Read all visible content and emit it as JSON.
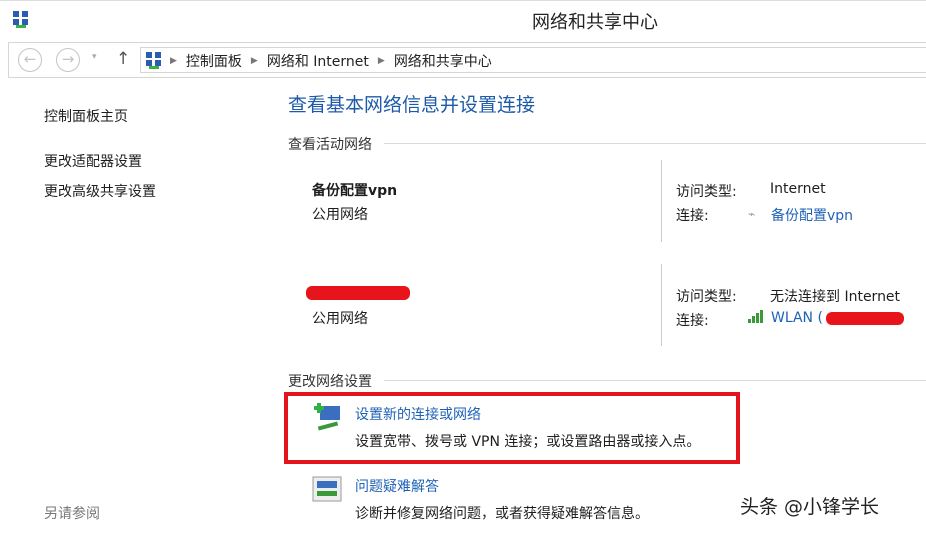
{
  "window": {
    "title": "网络和共享中心"
  },
  "breadcrumb": [
    "控制面板",
    "网络和 Internet",
    "网络和共享中心"
  ],
  "sidebar": {
    "items": [
      "控制面板主页",
      "更改适配器设置",
      "更改高级共享设置"
    ],
    "see_also": "另请参阅"
  },
  "main": {
    "heading": "查看基本网络信息并设置连接",
    "active_networks_label": "查看活动网络",
    "networks": [
      {
        "name": "备份配置vpn",
        "category": "公用网络",
        "access_type_label": "访问类型:",
        "access_type": "Internet",
        "connection_label": "连接:",
        "connection": "备份配置vpn"
      },
      {
        "name": "",
        "category": "公用网络",
        "access_type_label": "访问类型:",
        "access_type": "无法连接到 Internet",
        "connection_label": "连接:",
        "connection": "WLAN ("
      }
    ],
    "change_settings_label": "更改网络设置",
    "tasks": [
      {
        "title": "设置新的连接或网络",
        "desc": "设置宽带、拨号或 VPN 连接；或设置路由器或接入点。"
      },
      {
        "title": "问题疑难解答",
        "desc": "诊断并修复网络问题，或者获得疑难解答信息。"
      }
    ]
  },
  "watermark": "头条 @小锋学长",
  "colors": {
    "link": "#1e62b6",
    "highlight": "#e2141e"
  }
}
